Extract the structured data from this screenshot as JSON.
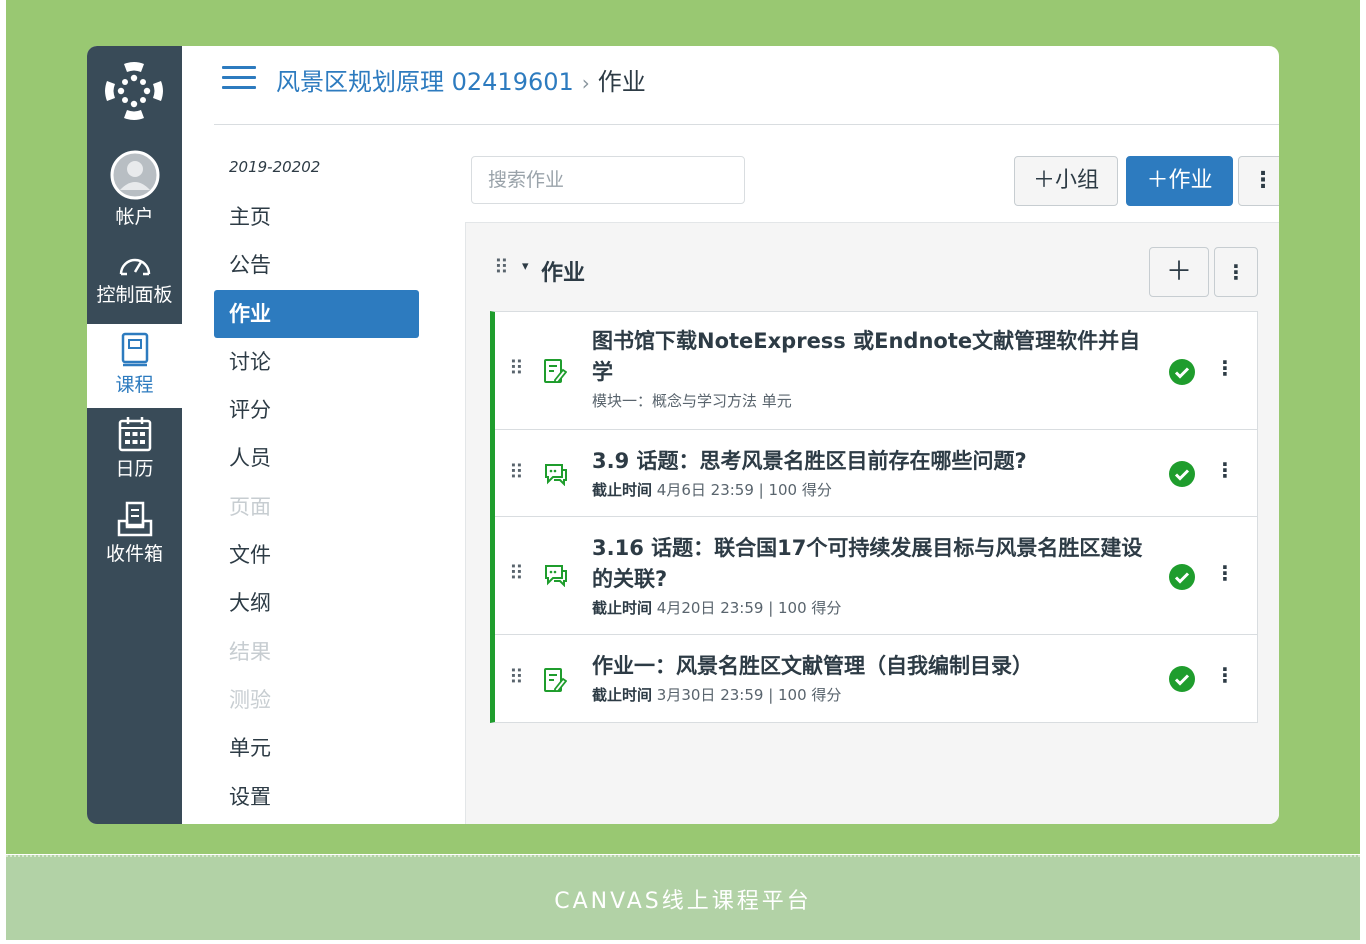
{
  "caption": "CANVAS线上课程平台",
  "global_nav": {
    "items": [
      {
        "label": "帐户",
        "icon": "account-avatar-icon"
      },
      {
        "label": "控制面板",
        "icon": "dashboard-gauge-icon"
      },
      {
        "label": "课程",
        "icon": "courses-book-icon"
      },
      {
        "label": "日历",
        "icon": "calendar-icon"
      },
      {
        "label": "收件箱",
        "icon": "inbox-icon"
      }
    ]
  },
  "header": {
    "course": "风景区规划原理 02419601",
    "separator": "›",
    "current": "作业"
  },
  "course_nav": {
    "term": "2019-20202",
    "items": [
      {
        "label": "主页"
      },
      {
        "label": "公告"
      },
      {
        "label": "作业"
      },
      {
        "label": "讨论"
      },
      {
        "label": "评分"
      },
      {
        "label": "人员"
      },
      {
        "label": "页面"
      },
      {
        "label": "文件"
      },
      {
        "label": "大纲"
      },
      {
        "label": "结果"
      },
      {
        "label": "测验"
      },
      {
        "label": "单元"
      },
      {
        "label": "设置"
      }
    ]
  },
  "toolbar": {
    "search_placeholder": "搜索作业",
    "group_button": "＋小组",
    "add_button": "＋作业",
    "more": "⋮"
  },
  "assignment_group": {
    "title": "作业",
    "caret": "▾",
    "grip": "⠿",
    "add": "＋",
    "more": "⋮",
    "items": [
      {
        "type_icon": "assignment-icon",
        "title": "图书馆下载NoteExpress 或Endnote文献管理软件并自学",
        "due_label": "",
        "meta": "模块一：概念与学习方法 单元",
        "points": ""
      },
      {
        "type_icon": "discussion-icon",
        "title": "3.9 话题：思考风景名胜区目前存在哪些问题?",
        "due_label": "截止时间",
        "meta": "4月6日 23:59 | 100 得分",
        "points": ""
      },
      {
        "type_icon": "discussion-icon",
        "title": "3.16 话题：联合国17个可持续发展目标与风景名胜区建设的关联?",
        "due_label": "截止时间",
        "meta": "4月20日 23:59 | 100 得分",
        "points": ""
      },
      {
        "type_icon": "assignment-icon",
        "title": "作业一：风景名胜区文献管理（自我编制目录）",
        "due_label": "截止时间",
        "meta": "3月30日 23:59 | 100 得分",
        "points": ""
      }
    ]
  },
  "colors": {
    "frame_green": "#99c872",
    "caption_bg": "#b2d2a6",
    "nav_dark": "#394b58",
    "brand_blue": "#2d7bbf",
    "published_green": "#1f9d2d"
  }
}
